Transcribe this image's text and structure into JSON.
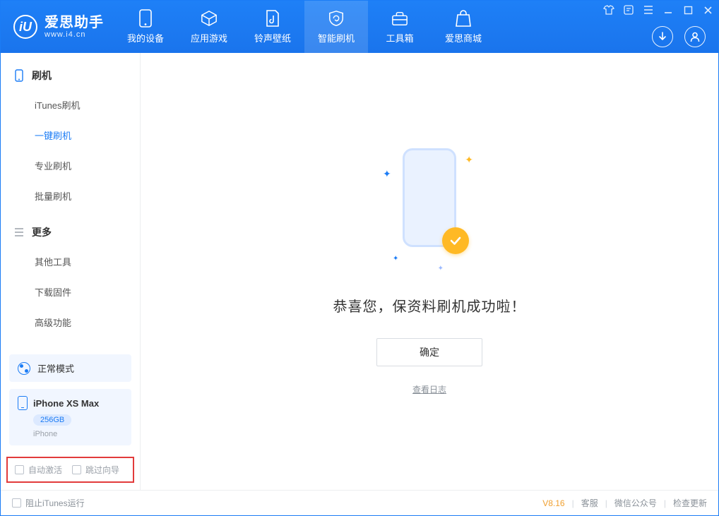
{
  "app": {
    "name": "爱思助手",
    "domain": "www.i4.cn",
    "version": "V8.16"
  },
  "topTabs": {
    "device": "我的设备",
    "apps": "应用游戏",
    "ring": "铃声壁纸",
    "flash": "智能刷机",
    "toolbox": "工具箱",
    "mall": "爱思商城"
  },
  "sidebar": {
    "group_flash": "刷机",
    "items_flash": {
      "itunes": "iTunes刷机",
      "oneclick": "一键刷机",
      "pro": "专业刷机",
      "batch": "批量刷机"
    },
    "group_more": "更多",
    "items_more": {
      "other": "其他工具",
      "firmware": "下载固件",
      "advanced": "高级功能"
    }
  },
  "mode": {
    "label": "正常模式"
  },
  "device": {
    "name": "iPhone XS Max",
    "storage": "256GB",
    "type": "iPhone"
  },
  "options": {
    "auto_activate": "自动激活",
    "skip_wizard": "跳过向导"
  },
  "main": {
    "success": "恭喜您，保资料刷机成功啦！",
    "ok": "确定",
    "view_log": "查看日志"
  },
  "statusbar": {
    "block_itunes": "阻止iTunes运行",
    "support": "客服",
    "wechat": "微信公众号",
    "update": "检查更新"
  }
}
